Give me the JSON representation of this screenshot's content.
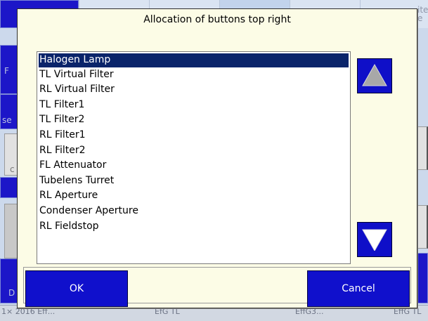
{
  "dialog": {
    "title": "Allocation of buttons top right",
    "list_items": [
      "Halogen Lamp",
      "TL Virtual Filter",
      "RL Virtual Filter",
      "TL Filter1",
      "TL Filter2",
      "RL Filter1",
      "RL Filter2",
      "FL Attenuator",
      "Tubelens Turret",
      "RL Aperture",
      "Condenser Aperture",
      "RL Fieldstop"
    ],
    "selected_index": 0,
    "scroll_up_icon": "triangle-up-icon",
    "scroll_down_icon": "triangle-down-icon",
    "ok_label": "OK",
    "cancel_label": "Cancel"
  },
  "background": {
    "left_labels": [
      "F",
      "se",
      "c",
      "D"
    ],
    "top_right_text": "ite\ne",
    "status_items": [
      "1× 2016 Eff...",
      "EfG TL",
      "EffG3...",
      "EffG TL"
    ]
  },
  "colors": {
    "accent_blue": "#1010cc",
    "selection": "#0a246a",
    "dialog_bg": "#fcfce6"
  }
}
